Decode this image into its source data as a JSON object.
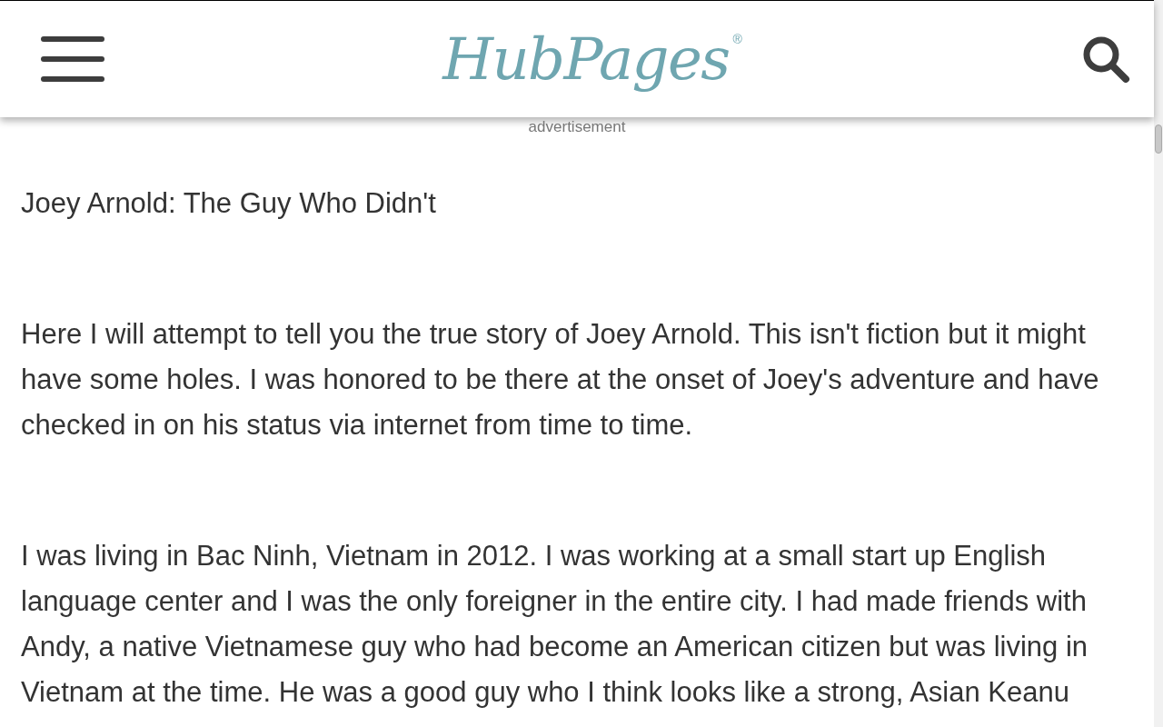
{
  "header": {
    "logo": "HubPages",
    "logo_mark": "®"
  },
  "advertisement_label": "advertisement",
  "article": {
    "title": "Joey Arnold: The Guy Who Didn't",
    "paragraphs": [
      "Here I will attempt to tell you the true story of Joey Arnold. This isn't fiction but it might have some holes. I was honored to be there at the onset of Joey's adventure and have checked in on his status via internet from time to time.",
      "I was living in Bac Ninh, Vietnam in 2012. I was working at a small start up English language center and I was the only foreigner in the entire city. I had made friends with Andy, a native Vietnamese guy who had become an American citizen but was living in Vietnam at the time. He was a good guy who I think looks like a strong, Asian Keanu"
    ]
  }
}
